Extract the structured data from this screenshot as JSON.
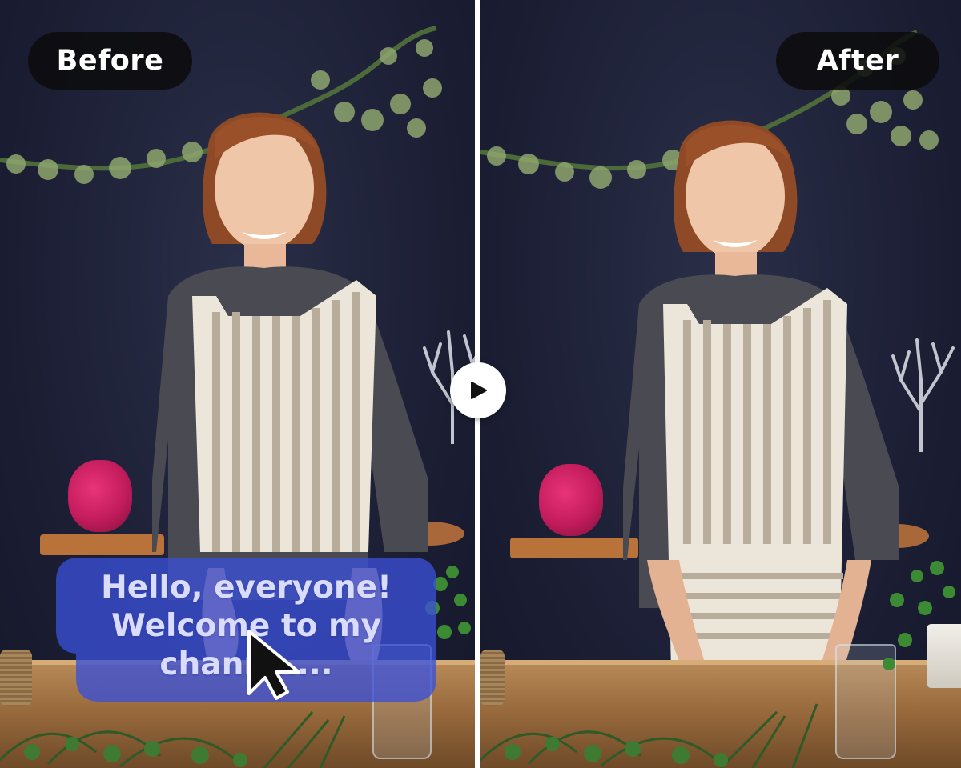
{
  "labels": {
    "before": "Before",
    "after": "After"
  },
  "caption": {
    "lines": [
      "Hello, everyone!",
      "Welcome to my",
      "chann…..."
    ]
  },
  "controls": {
    "play_icon": "play-icon",
    "cursor_icon": "mouse-cursor-icon"
  },
  "colors": {
    "label_bg": "#0c0c0e",
    "label_text": "#ffffff",
    "caption_bg": "#3a4fd6",
    "caption_text": "#d9dcff",
    "divider": "#ffffff"
  }
}
